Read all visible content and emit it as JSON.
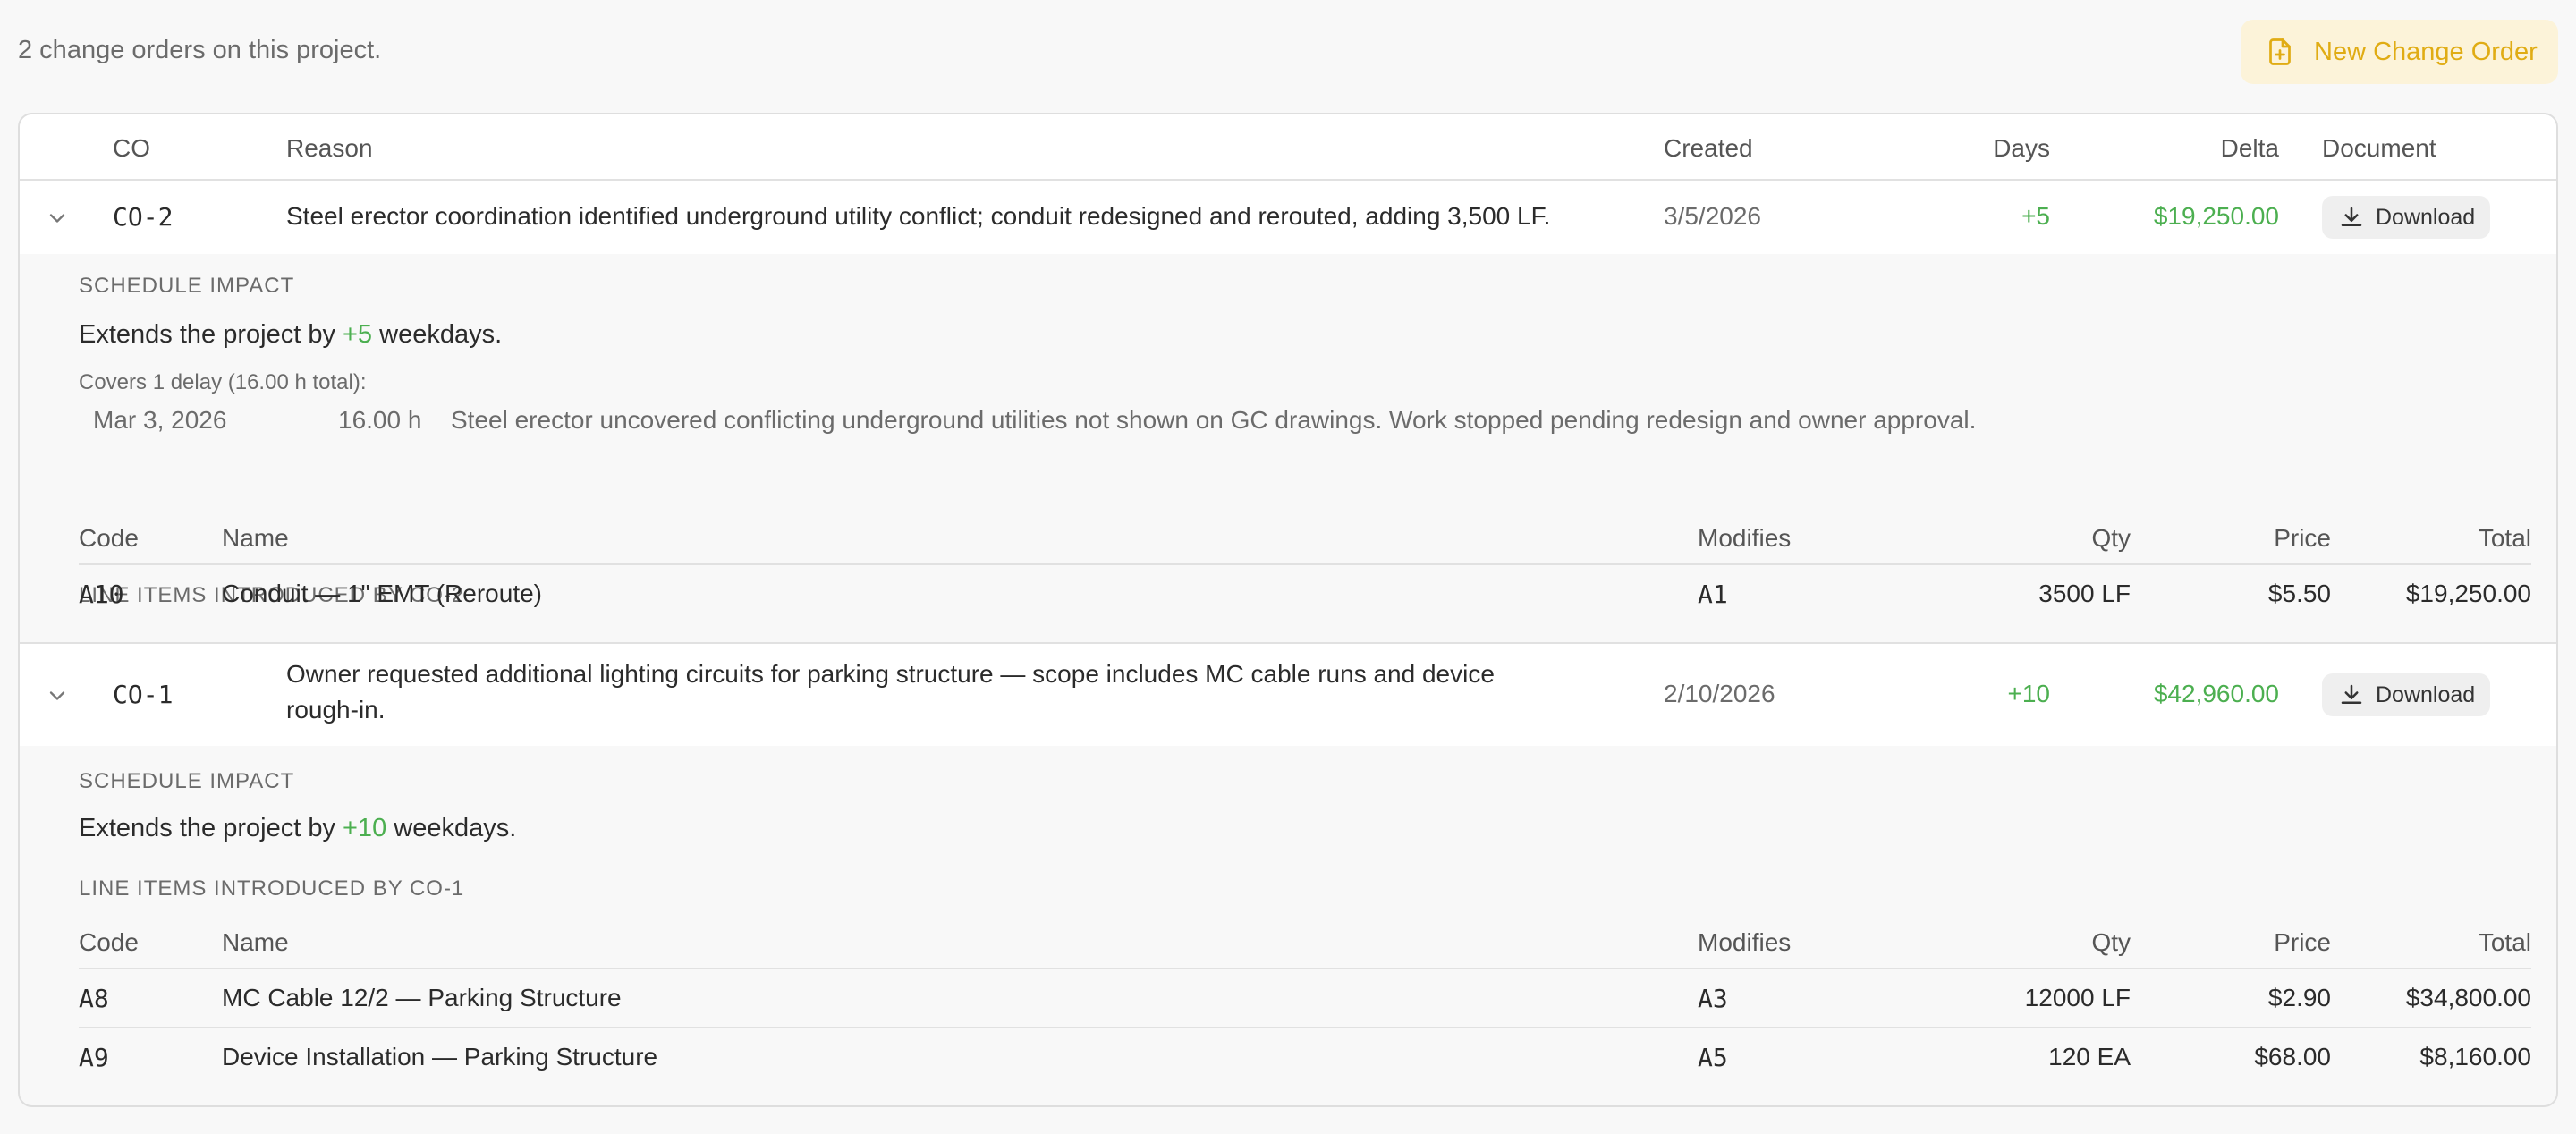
{
  "summary": "2 change orders on this project.",
  "new_button_label": "New Change Order",
  "colors": {
    "accent": "#e0ac14",
    "accent_bg": "#fcf3d9",
    "positive": "#4caf50"
  },
  "columns": {
    "co": "CO",
    "reason": "Reason",
    "created": "Created",
    "days": "Days",
    "delta": "Delta",
    "document": "Document"
  },
  "line_item_columns": {
    "code": "Code",
    "name": "Name",
    "modifies": "Modifies",
    "qty": "Qty",
    "price": "Price",
    "total": "Total"
  },
  "change_orders": [
    {
      "id": "CO-2",
      "reason_line1": "Steel erector coordination identified underground utility conflict; conduit redesigned and rerouted, adding 3,500 LF.",
      "created": "3/5/2026",
      "days": "+5",
      "delta": "$19,250.00",
      "download_label": "Download",
      "schedule_label": "SCHEDULE IMPACT",
      "impact_prefix": "Extends the project by ",
      "impact_days": "+5",
      "impact_suffix": " weekdays.",
      "covers": "Covers 1 delay (16.00 h total):",
      "delays": [
        {
          "date": "Mar 3, 2026",
          "hours": "16.00 h",
          "description": "Steel erector uncovered conflicting underground utilities not shown on GC drawings. Work stopped pending redesign and owner approval."
        }
      ],
      "line_items_label": "LINE ITEMS INTRODUCED BY CO-2",
      "line_items": [
        {
          "code": "A10",
          "name": "Conduit — 1\" EMT (Reroute)",
          "modifies": "A1",
          "qty": "3500 LF",
          "price": "$5.50",
          "total": "$19,250.00"
        }
      ]
    },
    {
      "id": "CO-1",
      "reason_line1": "Owner requested additional lighting circuits for parking structure — scope includes MC cable runs and device",
      "reason_line2": "rough-in.",
      "created": "2/10/2026",
      "days": "+10",
      "delta": "$42,960.00",
      "download_label": "Download",
      "schedule_label": "SCHEDULE IMPACT",
      "impact_prefix": "Extends the project by ",
      "impact_days": "+10",
      "impact_suffix": " weekdays.",
      "line_items_label": "LINE ITEMS INTRODUCED BY CO-1",
      "line_items": [
        {
          "code": "A8",
          "name": "MC Cable 12/2 — Parking Structure",
          "modifies": "A3",
          "qty": "12000 LF",
          "price": "$2.90",
          "total": "$34,800.00"
        },
        {
          "code": "A9",
          "name": "Device Installation — Parking Structure",
          "modifies": "A5",
          "qty": "120 EA",
          "price": "$68.00",
          "total": "$8,160.00"
        }
      ]
    }
  ]
}
